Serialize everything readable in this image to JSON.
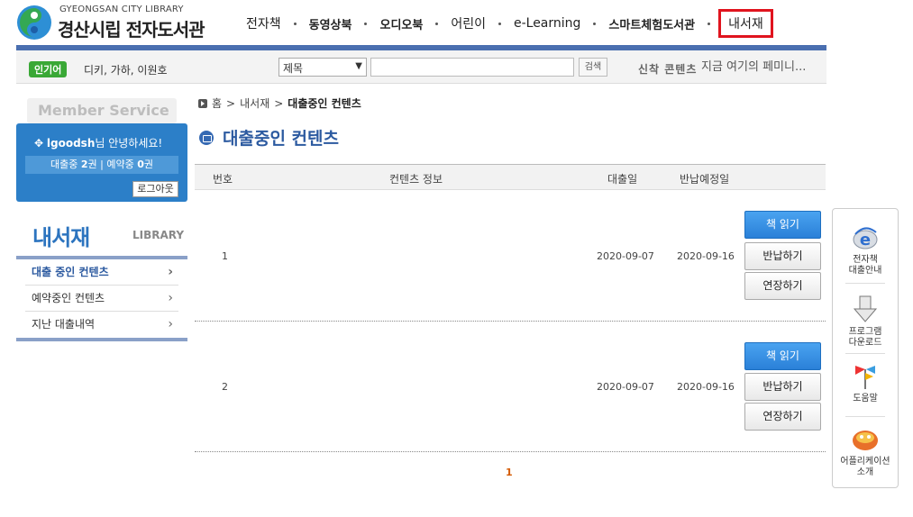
{
  "header": {
    "logo_en": "GYEONGSAN CITY LIBRARY",
    "logo_ko": "경산시립 전자도서관",
    "nav": [
      {
        "label": "전자책",
        "style": "light"
      },
      {
        "label": "동영상북",
        "style": "bold"
      },
      {
        "label": "오디오북",
        "style": "bold"
      },
      {
        "label": "어린이",
        "style": "light"
      },
      {
        "label": "e-Learning",
        "style": "light"
      },
      {
        "label": "스마트체험도서관",
        "style": "bold"
      },
      {
        "label": "내서재",
        "style": "active"
      }
    ]
  },
  "searchbar": {
    "popular_badge": "인기어",
    "popular_words": "디키, 가하, 이원호",
    "select_value": "제목",
    "search_button": "검색",
    "new_label": "신착 콘텐츠",
    "new_title": "지금 여기의 페미니..."
  },
  "sidebar": {
    "member_service": "Member Service",
    "user": "lgoodsh",
    "greeting_suffix": "님 안녕하세요!",
    "loan_label": "대출중",
    "loan_count": "2",
    "reserve_label": "예약중",
    "reserve_count": "0",
    "unit": "권",
    "logout": "로그아웃",
    "library_title": "내서재",
    "library_sub": "LIBRARY",
    "menu": [
      {
        "label": "대출 중인 컨텐츠",
        "active": true
      },
      {
        "label": "예약중인 컨텐츠",
        "active": false
      },
      {
        "label": "지난 대출내역",
        "active": false
      }
    ]
  },
  "content": {
    "breadcrumb": [
      "홈",
      "내서재",
      "대출중인 컨텐츠"
    ],
    "title": "대출중인 컨텐츠",
    "columns": {
      "no": "번호",
      "info": "컨텐츠 정보",
      "loan_date": "대출일",
      "due_date": "반납예정일"
    },
    "rows": [
      {
        "no": "1",
        "loan_date": "2020-09-07",
        "due_date": "2020-09-16"
      },
      {
        "no": "2",
        "loan_date": "2020-09-07",
        "due_date": "2020-09-16"
      }
    ],
    "buttons": {
      "read": "책 읽기",
      "return": "반납하기",
      "extend": "연장하기"
    },
    "pager": "1"
  },
  "quick_menu": [
    {
      "label_1": "전자책",
      "label_2": "대출안내",
      "icon": "ebook-guide-icon"
    },
    {
      "label_1": "프로그램",
      "label_2": "다운로드",
      "icon": "download-icon"
    },
    {
      "label_1": "도움말",
      "label_2": "",
      "icon": "help-icon"
    },
    {
      "label_1": "어플리케이션",
      "label_2": "소개",
      "icon": "app-icon"
    }
  ],
  "colors": {
    "brand_blue": "#2c7fc8",
    "active_red": "#e0141e",
    "popular_green": "#3aa836"
  }
}
